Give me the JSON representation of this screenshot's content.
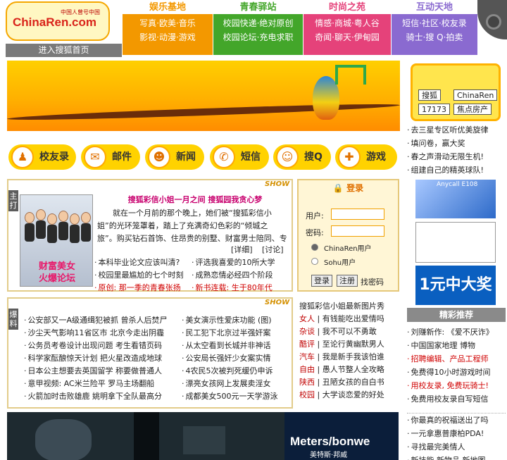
{
  "header": {
    "logo_text": "ChinaRen.com",
    "logo_tagline": "中国人曾号中国",
    "home_link": "进入搜狐首页",
    "nav": [
      {
        "title": "娱乐基地",
        "rows": [
          "写真·欧美·音乐",
          "影视·动漫·游戏"
        ],
        "color": "#f39800"
      },
      {
        "title": "青春驿站",
        "rows": [
          "校园快递·绝对原创",
          "校园论坛·充电求职"
        ],
        "color": "#43a62a"
      },
      {
        "title": "时尚之苑",
        "rows": [
          "情感·商城·粤人谷",
          "奇闻·聊天·伊甸园"
        ],
        "color": "#e5427a"
      },
      {
        "title": "互动天地",
        "rows": [
          "短信·社区·校友录",
          "骑士·搜  Q·拍卖"
        ],
        "color": "#8a6ad0"
      }
    ]
  },
  "promo_buttons": [
    "搜狐",
    "ChinaRen",
    "17173",
    "焦点房产"
  ],
  "icon_buttons": [
    {
      "label": "校友录",
      "icon": "person-icon",
      "glyph": "♟"
    },
    {
      "label": "邮件",
      "icon": "mail-icon",
      "glyph": "✉"
    },
    {
      "label": "新闻",
      "icon": "news-icon",
      "glyph": "☻"
    },
    {
      "label": "短信",
      "icon": "phone-icon",
      "glyph": "✆"
    },
    {
      "label": "搜Q",
      "icon": "smiley-icon",
      "glyph": "☺"
    },
    {
      "label": "游戏",
      "icon": "gamepad-icon",
      "glyph": "✚"
    }
  ],
  "right_links_top": [
    "去三星专区听优美旋律",
    "填问卷，赢大奖",
    "春之声滑动无限生机!",
    "组建自己的精英球队!"
  ],
  "feature": {
    "tag": "主打",
    "show": "SHOW",
    "headline": "搜狐彩信小姐一月之间  搜狐园我贪心梦",
    "body": "就在一个月前的那个晚上，她们被“搜狐彩信小姐”的光环笼罩着，踏上了充满奇幻色彩的“倾城之旅”。购买钻石首饰、住昂贵的别墅、财富男士陪同、专机接送、出席名流见面会……",
    "detail": "[详细]",
    "discuss": "[讨论]",
    "photo_caption_1": "财富美女",
    "photo_caption_2": "火爆论坛",
    "links_left": [
      "本科毕业论文应该叫清?",
      "校园里最尴尬的七个时刻",
      "原创: 那一季的青春张扬"
    ],
    "links_right": [
      "评选我喜爱的10所大学",
      "成熟恋情必经四个阶段",
      "新书连载: 生于80年代"
    ]
  },
  "burst": {
    "tag": "爆料",
    "show": "SHOW",
    "left": [
      "公安部又一A级通缉犯被抓  曾杀人后焚尸",
      "沙尘天气影响11省区市   北京今走出阴霾",
      "公务员考卷设计出现问题   考生看错页码",
      "科学家酝酿惊天计划   把火星改造成地球",
      "日本公主想要去英国留学   称要做普通人",
      "意甲视频: AC米兰险平   罗马主场翻船",
      "火箭加时击败雄鹿  姚明拿下全队最高分"
    ],
    "right": [
      "美女演示性爱床功能 (图)",
      "民工犯下北京过半强奸案",
      "从太空看到长城并非神话",
      "公安局长强奸少女案实情",
      "4农民5次被判死缓仍申诉",
      "漂亮女孩网上发展卖淫女",
      "成都美女500元一天学游泳"
    ]
  },
  "login": {
    "title": "登录",
    "user_label": "用户:",
    "pass_label": "密码:",
    "opt1": "ChinaRen用户",
    "opt2": "Sohu用户",
    "login_btn": "登录",
    "register_btn": "注册",
    "forgot": "找密码"
  },
  "mms": {
    "title": "搜狐彩信小姐最新图片秀",
    "items": [
      {
        "cat": "女人",
        "text": "有钱能吃出爱情吗"
      },
      {
        "cat": "杂谈",
        "text": "我不可以不勇敢"
      },
      {
        "cat": "酷评",
        "text": "至论行黄幽默男人"
      },
      {
        "cat": "汽车",
        "text": "我是新手我该怕谁"
      },
      {
        "cat": "自由",
        "text": "愚人节整人全攻略"
      },
      {
        "cat": "陕西",
        "text": "丑陋女孩的自白书"
      },
      {
        "cat": "校园",
        "text": "大学谈恋爱的好处"
      }
    ]
  },
  "ads": {
    "anycall": "Anycall E108",
    "lottery": "1元中大奖",
    "meters": "Meters/bonwe",
    "meters_cn": "美特斯·邦威"
  },
  "picks": {
    "title": "精彩推荐",
    "items": [
      {
        "text": "刘赚新作: 《爱不厌诈》",
        "red": false
      },
      {
        "text": "中国国家地理  博物",
        "red": false
      },
      {
        "text": "招聘编辑、产品工程师",
        "red": true
      },
      {
        "text": "免费得10小时游戏时间",
        "red": false
      },
      {
        "text": "用校友录, 免费玩骑士!",
        "red": true
      },
      {
        "text": "免费用校友录自写短信",
        "red": false
      }
    ]
  },
  "bottom_links": [
    "你最真的祝福送出了吗",
    "一元拿惠普康柏PDA!",
    "寻找最完美情人",
    "新技能  新物品  新地图"
  ]
}
